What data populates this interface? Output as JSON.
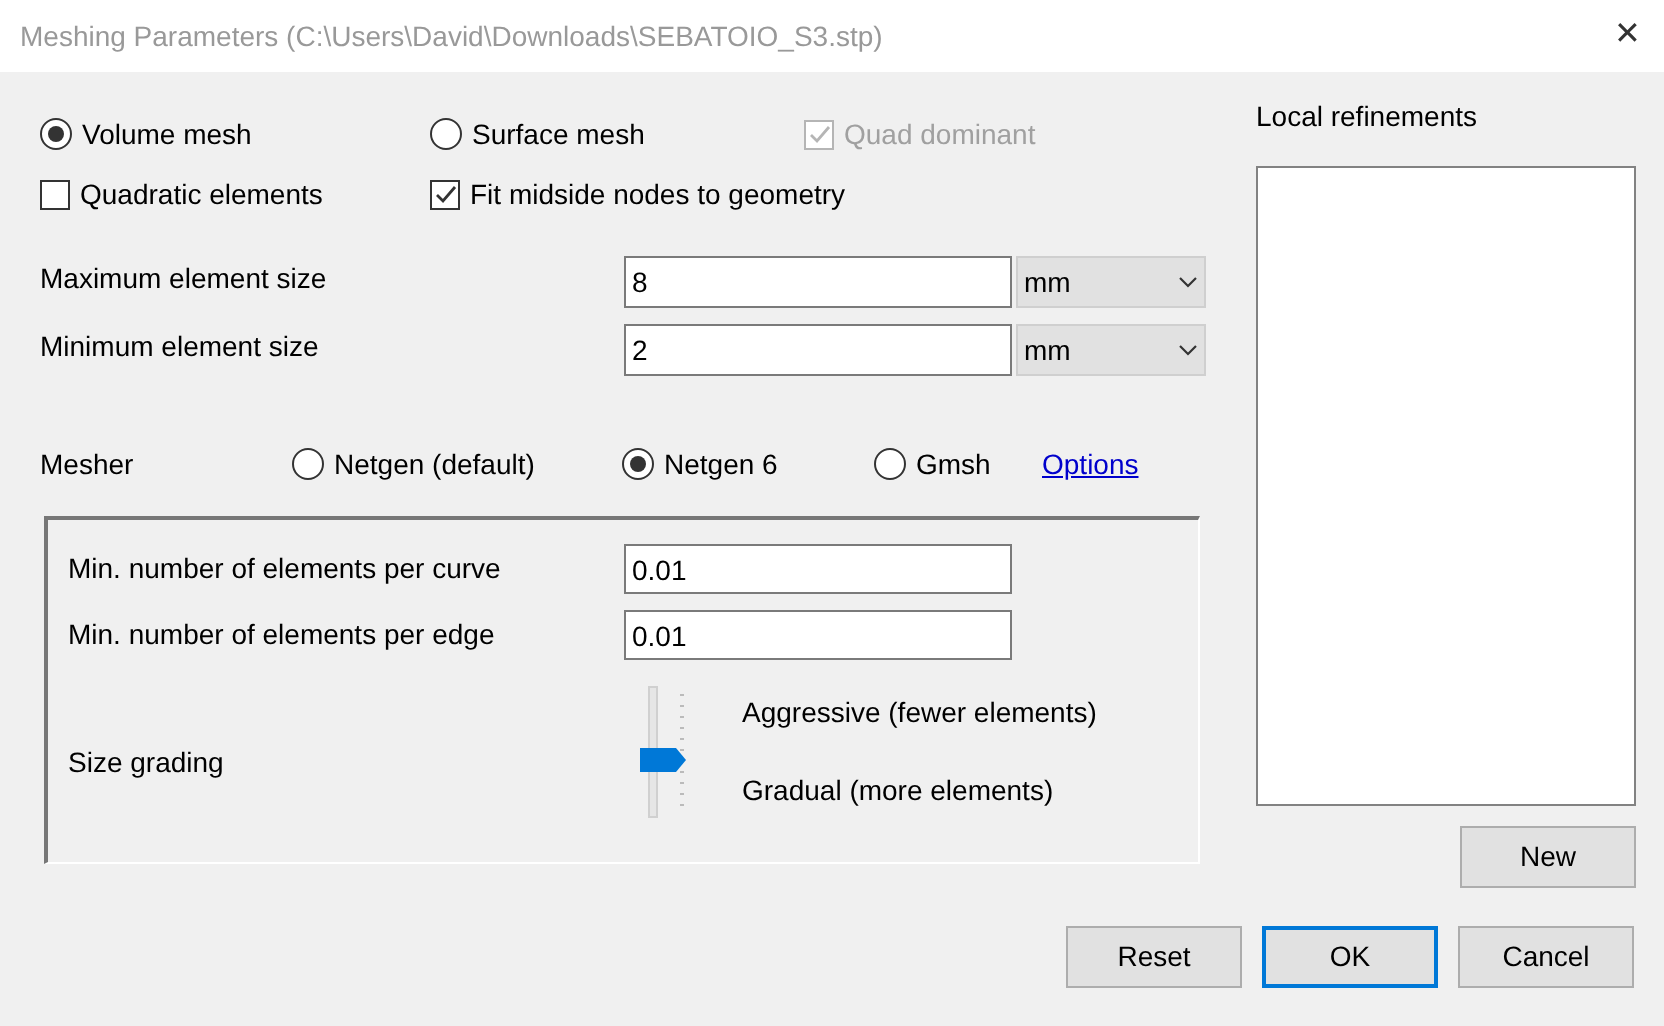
{
  "window": {
    "title": "Meshing Parameters (C:\\Users\\David\\Downloads\\SEBATOIO_S3.stp)",
    "close": "✕"
  },
  "mesh_type": [
    {
      "label": "Volume mesh",
      "selected": true
    },
    {
      "label": "Surface mesh",
      "selected": false
    }
  ],
  "quad_dominant": {
    "label": "Quad dominant",
    "checked": true,
    "disabled": true
  },
  "quadratic_elements": {
    "label": "Quadratic elements",
    "checked": false
  },
  "fit_midside": {
    "label": "Fit midside nodes to geometry",
    "checked": true
  },
  "sizes": [
    {
      "label": "Maximum element size",
      "value": "8",
      "unit": "mm"
    },
    {
      "label": "Minimum element size",
      "value": "2",
      "unit": "mm"
    }
  ],
  "mesher": {
    "label": "Mesher",
    "options": [
      {
        "label": "Netgen (default)",
        "selected": false
      },
      {
        "label": "Netgen 6",
        "selected": true
      },
      {
        "label": "Gmsh",
        "selected": false
      }
    ],
    "link": "Options"
  },
  "netgen_fields": [
    {
      "label": "Min. number of elements per curve",
      "value": "0.01"
    },
    {
      "label": "Min. number of elements per edge",
      "value": "0.01"
    }
  ],
  "size_grading": {
    "label": "Size grading",
    "level": 0.45,
    "top_label": "Aggressive (fewer elements)",
    "bottom_label": "Gradual (more elements)"
  },
  "local_refinements": {
    "title": "Local refinements",
    "new_button": "New"
  },
  "buttons": [
    {
      "label": "Reset",
      "default": false
    },
    {
      "label": "OK",
      "default": true
    },
    {
      "label": "Cancel",
      "default": false
    }
  ]
}
